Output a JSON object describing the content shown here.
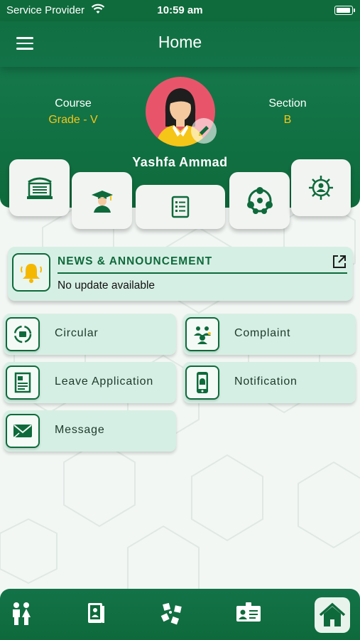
{
  "status_bar": {
    "carrier": "Service Provider",
    "time": "10:59 am"
  },
  "header": {
    "title": "Home",
    "menu_icon": "hamburger-icon"
  },
  "profile": {
    "course_label": "Course",
    "course_value": "Grade - V",
    "section_label": "Section",
    "section_value": "B",
    "name": "Yashfa Ammad",
    "avatar_icon": "student-avatar",
    "edit_icon": "pencil-icon"
  },
  "quick_tiles": [
    {
      "name": "school-tile",
      "icon": "school-building-icon"
    },
    {
      "name": "graduation-tile",
      "icon": "graduate-icon"
    },
    {
      "name": "document-tile",
      "icon": "document-list-icon"
    },
    {
      "name": "network-tile",
      "icon": "people-network-icon"
    },
    {
      "name": "settings-tile",
      "icon": "gear-user-icon"
    }
  ],
  "news": {
    "title": "NEWS & ANNOUNCEMENT",
    "text": "No update available",
    "icon": "bell-icon",
    "link_icon": "external-link-icon"
  },
  "menu": {
    "circular": "Circular",
    "complaint": "Complaint",
    "leave_application": "Leave Application",
    "notification": "Notification",
    "message": "Message"
  },
  "bottom_nav": [
    "children-icon",
    "book-icon",
    "puzzle-icon",
    "id-card-icon",
    "home-icon"
  ],
  "colors": {
    "primary": "#0e6a3b",
    "accent": "#f5c518",
    "card_bg": "#d6efe4",
    "bell": "#f5b800"
  }
}
